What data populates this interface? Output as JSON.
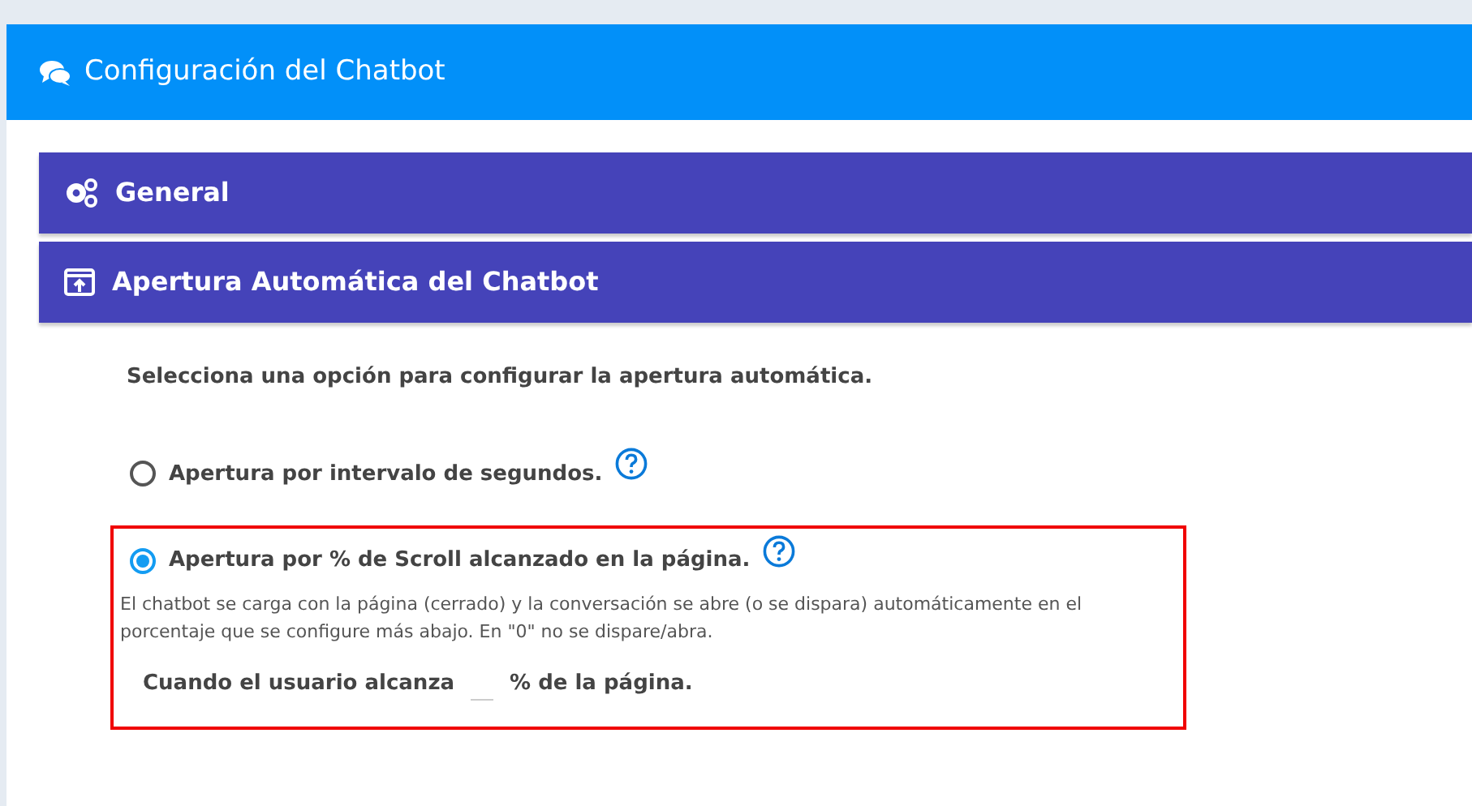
{
  "header": {
    "title": "Configuración del Chatbot"
  },
  "sections": [
    {
      "title": "General",
      "kind": "settings"
    },
    {
      "title": "Apertura Automática del Chatbot",
      "kind": "open"
    }
  ],
  "intro": "Selecciona una opción para configurar la apertura automática.",
  "options": [
    {
      "label": "Apertura por intervalo de segundos.",
      "selected": false
    },
    {
      "label": "Apertura por % de Scroll alcanzado en la página.",
      "selected": true,
      "description": "El chatbot se carga con la página (cerrado) y la conversación se abre (o se dispara) automáticamente en el porcentaje que se configure más abajo. En \"0\" no se dispare/abra.",
      "field_before": "Cuando el usuario alcanza",
      "field_after": "% de la página."
    }
  ]
}
